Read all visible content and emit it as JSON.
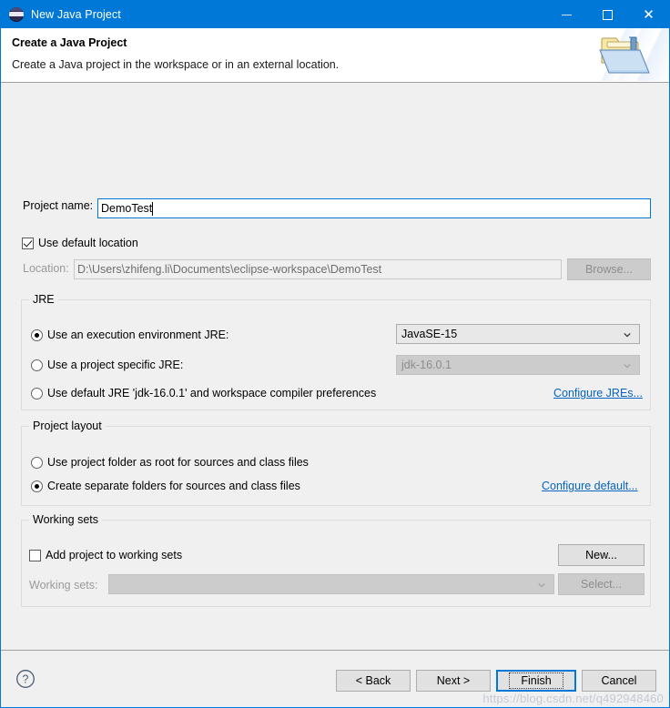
{
  "window": {
    "title": "New Java Project",
    "icon": "eclipse-icon",
    "controls": {
      "minimize": "minimize-icon",
      "maximize": "maximize-icon",
      "close": "close-icon"
    },
    "titlebar_color": "#0078d7"
  },
  "banner": {
    "title": "Create a Java Project",
    "description": "Create a Java project in the workspace or in an external location.",
    "icon": "java-project-folder-icon"
  },
  "form": {
    "project_name_label": "Project name:",
    "project_name_value": "DemoTest",
    "use_default_location_label": "Use default location",
    "use_default_location_checked": true,
    "location_label": "Location:",
    "location_value": "D:\\Users\\zhifeng.li\\Documents\\eclipse-workspace\\DemoTest",
    "location_enabled": false,
    "browse_label": "Browse...",
    "browse_enabled": false
  },
  "jre": {
    "group_title": "JRE",
    "options": [
      {
        "label": "Use an execution environment JRE:",
        "selected": true
      },
      {
        "label": "Use a project specific JRE:",
        "selected": false
      },
      {
        "label": "Use default JRE 'jdk-16.0.1' and workspace compiler preferences",
        "selected": false
      }
    ],
    "execution_environment_value": "JavaSE-15",
    "execution_environment_enabled": true,
    "project_specific_value": "jdk-16.0.1",
    "project_specific_enabled": false,
    "configure_link": "Configure JREs..."
  },
  "project_layout": {
    "group_title": "Project layout",
    "options": [
      {
        "label": "Use project folder as root for sources and class files",
        "selected": false
      },
      {
        "label": "Create separate folders for sources and class files",
        "selected": true
      }
    ],
    "configure_link": "Configure default..."
  },
  "working_sets": {
    "group_title": "Working sets",
    "add_label": "Add project to working sets",
    "add_checked": false,
    "new_label": "New...",
    "new_enabled": true,
    "working_sets_label": "Working sets:",
    "working_sets_value": "",
    "working_sets_enabled": false,
    "select_label": "Select...",
    "select_enabled": false
  },
  "footer": {
    "help_icon": "help-icon",
    "buttons": [
      {
        "label": "< Back",
        "enabled": true,
        "default": false
      },
      {
        "label": "Next >",
        "enabled": true,
        "default": false
      },
      {
        "label": "Finish",
        "enabled": true,
        "default": true
      },
      {
        "label": "Cancel",
        "enabled": true,
        "default": false
      }
    ]
  },
  "watermark": "https://blog.csdn.net/q492948460"
}
